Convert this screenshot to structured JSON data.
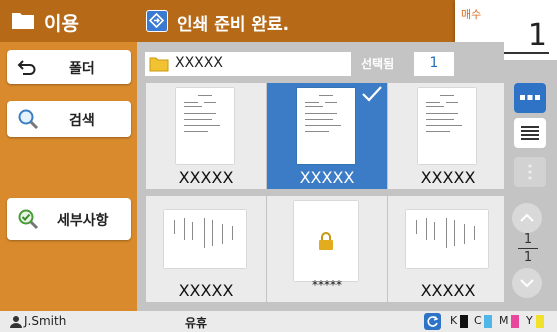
{
  "sidebar": {
    "title": "이용",
    "buttons": [
      {
        "label": "폴더",
        "icon": "back-arrow-icon"
      },
      {
        "label": "검색",
        "icon": "search-icon"
      },
      {
        "label": "세부사항",
        "icon": "check-magnifier-icon"
      }
    ]
  },
  "header": {
    "status_text": "인쇄 준비 완료."
  },
  "copies": {
    "label": "매수",
    "value": "1"
  },
  "pathbar": {
    "folder_name": "XXXXX",
    "selected_label": "선택됨",
    "selected_count": "1"
  },
  "files": [
    {
      "name": "XXXXX",
      "selected": false,
      "locked": false
    },
    {
      "name": "XXXXX",
      "selected": true,
      "locked": false
    },
    {
      "name": "XXXXX",
      "selected": false,
      "locked": false
    },
    {
      "name": "XXXXX",
      "selected": false,
      "locked": false
    },
    {
      "name": "*****",
      "selected": false,
      "locked": true
    },
    {
      "name": "XXXXX",
      "selected": false,
      "locked": false
    }
  ],
  "pager": {
    "current": "1",
    "total": "1"
  },
  "statusbar": {
    "user": "J.Smith",
    "state": "유휴",
    "inks": [
      "K",
      "C",
      "M",
      "Y"
    ]
  },
  "colors": {
    "accent_orange": "#d98a2c",
    "header_brown": "#b66a17",
    "select_blue": "#3c7bc6",
    "ink_k": "#111111",
    "ink_c": "#4fb6e8",
    "ink_m": "#e8479b",
    "ink_y": "#f2e12a"
  }
}
